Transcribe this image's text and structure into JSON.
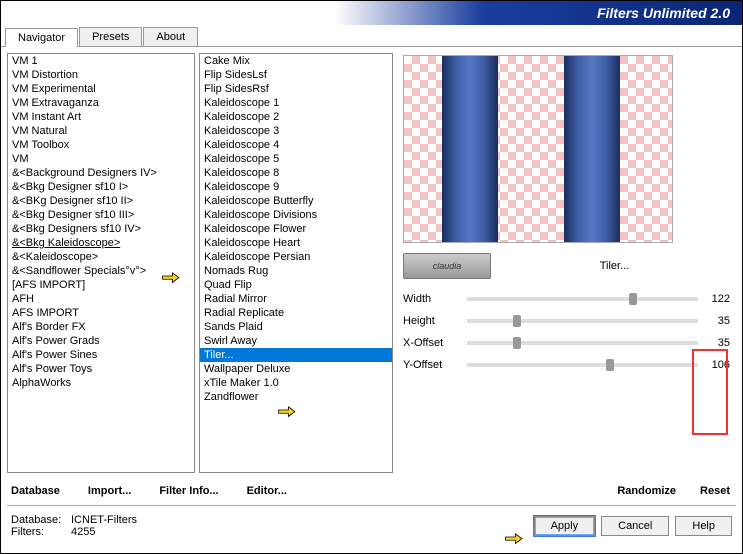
{
  "title": "Filters Unlimited 2.0",
  "tabs": [
    "Navigator",
    "Presets",
    "About"
  ],
  "active_tab": 0,
  "left_list": [
    "VM 1",
    "VM Distortion",
    "VM Experimental",
    "VM Extravaganza",
    "VM Instant Art",
    "VM Natural",
    "VM Toolbox",
    "VM",
    "&<Background Designers IV>",
    "&<Bkg Designer sf10 I>",
    "&<BKg Designer sf10 II>",
    "&<Bkg Designer sf10 III>",
    "&<Bkg Designers sf10 IV>",
    "&<Bkg Kaleidoscope>",
    "&<Kaleidoscope>",
    "&<Sandflower Specials°v°>",
    "[AFS IMPORT]",
    "AFH",
    "AFS IMPORT",
    "Alf's Border FX",
    "Alf's Power Grads",
    "Alf's Power Sines",
    "Alf's Power Toys",
    "AlphaWorks"
  ],
  "left_hover_index": 13,
  "mid_list": [
    "Cake Mix",
    "Flip SidesLsf",
    "Flip SidesRsf",
    "Kaleidoscope 1",
    "Kaleidoscope 2",
    "Kaleidoscope 3",
    "Kaleidoscope 4",
    "Kaleidoscope 5",
    "Kaleidoscope 8",
    "Kaleidoscope 9",
    "Kaleidoscope Butterfly",
    "Kaleidoscope Divisions",
    "Kaleidoscope Flower",
    "Kaleidoscope Heart",
    "Kaleidoscope Persian",
    "Nomads Rug",
    "Quad Flip",
    "Radial Mirror",
    "Radial Replicate",
    "Sands Plaid",
    "Swirl Away",
    "Tiler...",
    "Wallpaper Deluxe",
    "xTile Maker 1.0",
    "Zandflower"
  ],
  "mid_selected_index": 21,
  "stamp_text": "claudia",
  "filter_title": "Tiler...",
  "params": [
    {
      "label": "Width",
      "value": "122"
    },
    {
      "label": "Height",
      "value": "35"
    },
    {
      "label": "X-Offset",
      "value": "35"
    },
    {
      "label": "Y-Offset",
      "value": "106"
    }
  ],
  "under_left_buttons": [
    "Database",
    "Import...",
    "Filter Info...",
    "Editor..."
  ],
  "right_buttons": [
    "Randomize",
    "Reset"
  ],
  "footer": {
    "db_label": "Database:",
    "db_value": "ICNET-Filters",
    "flt_label": "Filters:",
    "flt_value": "4255"
  },
  "winbtns": [
    "Apply",
    "Cancel",
    "Help"
  ]
}
